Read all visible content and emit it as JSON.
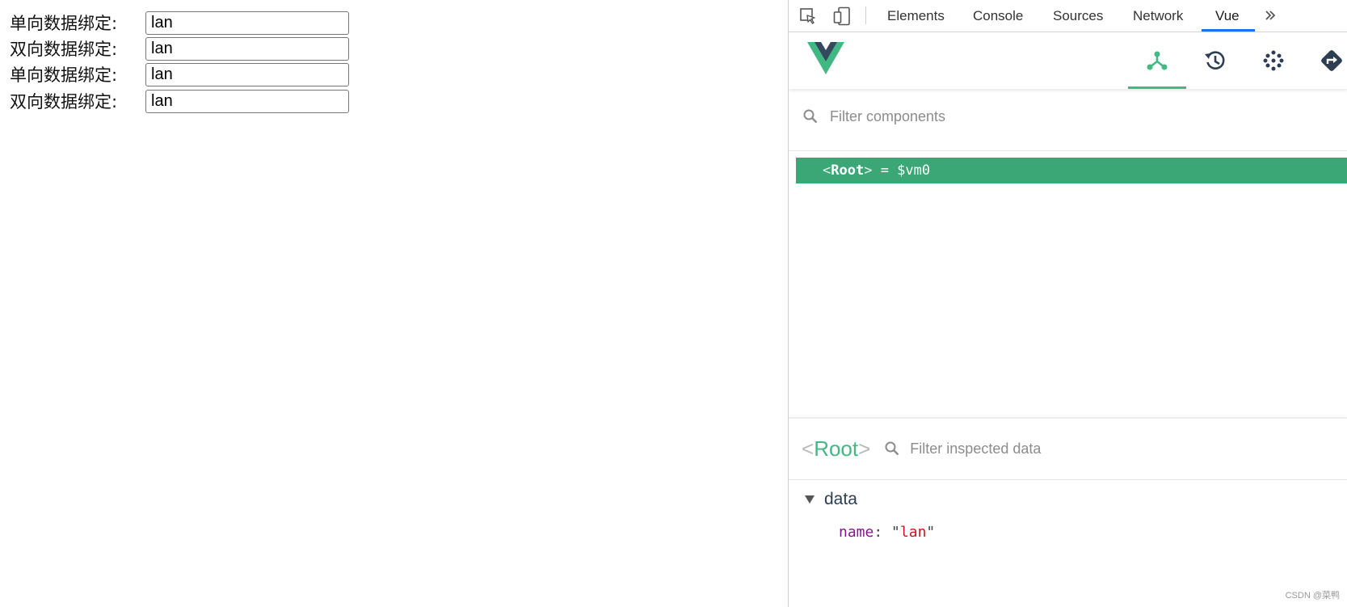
{
  "app": {
    "rows": [
      {
        "label": "单向数据绑定:",
        "value": "lan"
      },
      {
        "label": "双向数据绑定:",
        "value": "lan"
      },
      {
        "label": "单向数据绑定:",
        "value": "lan"
      },
      {
        "label": "双向数据绑定:",
        "value": "lan"
      }
    ]
  },
  "devtools": {
    "tabs": [
      "Elements",
      "Console",
      "Sources",
      "Network",
      "Vue"
    ],
    "active_tab": "Vue",
    "more_icon": "chevron-double-right-icon",
    "vue": {
      "accent": "#42b883",
      "actions": [
        "components-icon",
        "history-icon",
        "vuex-icon",
        "routing-icon"
      ],
      "component_filter_placeholder": "Filter components",
      "tree": {
        "open_bracket": "<",
        "name": "Root",
        "close_bracket": ">",
        "suffix": " = $vm0"
      },
      "inspector": {
        "open_bracket": "<",
        "component": "Root",
        "close_bracket": ">",
        "filter_placeholder": "Filter inspected data",
        "section": "data",
        "property": {
          "key": "name",
          "value": "lan"
        }
      }
    }
  },
  "watermark": "CSDN @菜鸭"
}
